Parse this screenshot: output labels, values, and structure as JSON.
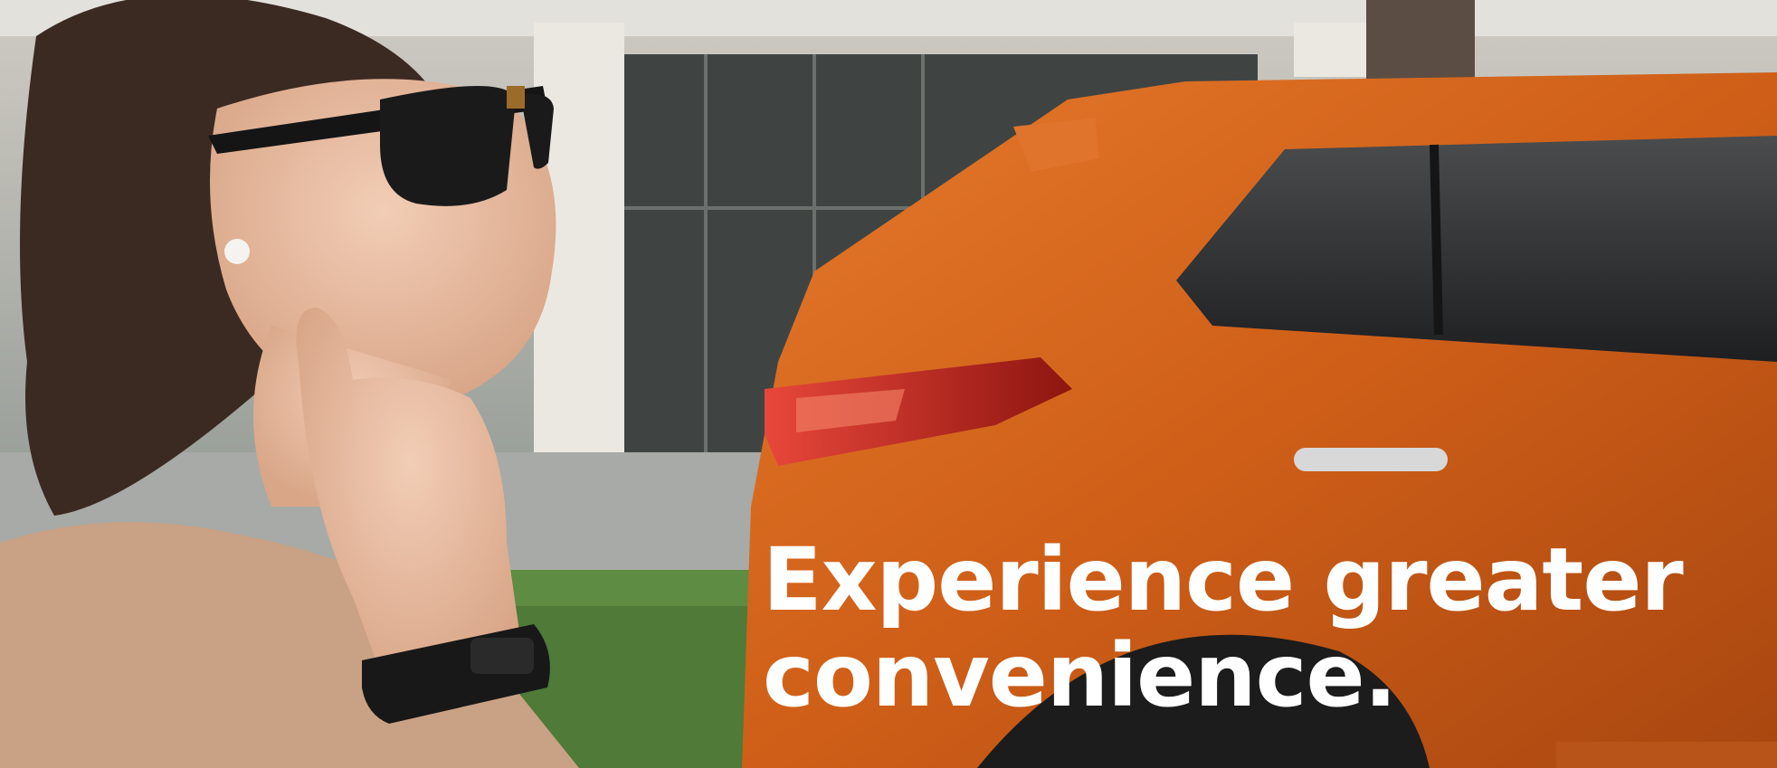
{
  "headline": {
    "line1": "Experience greater",
    "line2": "convenience."
  },
  "scene": {
    "subjects": [
      "woman-with-sunglasses",
      "smart-watch-band",
      "orange-suv"
    ],
    "colors": {
      "car_body": "#d4621a",
      "tail_light": "#b5241a",
      "shirt": "#c9a184",
      "hair": "#3b2a22",
      "skin": "#e9bfa6",
      "building": "#d9d6cf",
      "hedge": "#4f7a37",
      "text": "#ffffff"
    }
  }
}
